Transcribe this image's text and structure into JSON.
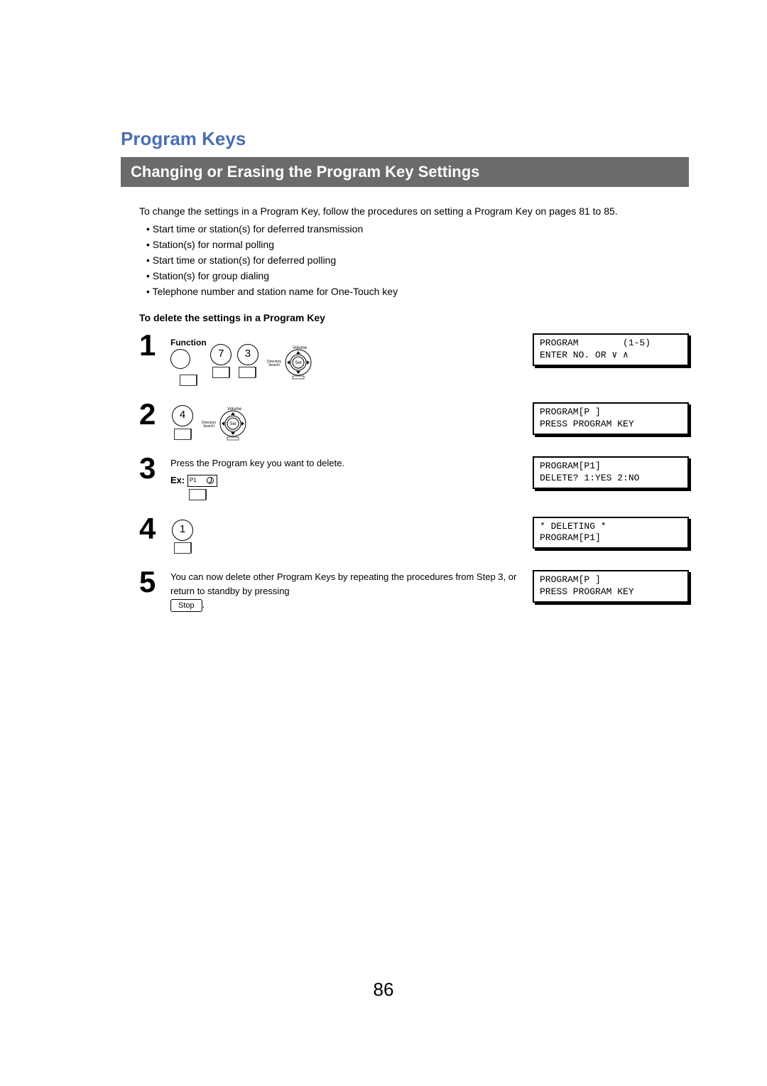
{
  "section_heading": "Program Keys",
  "title_bar": "Changing or Erasing the Program Key Settings",
  "intro_text": "To change the settings in a Program Key, follow the procedures on setting a Program Key on pages 81 to 85.",
  "bullets": [
    "Start time or station(s) for deferred transmission",
    "Station(s) for normal polling",
    "Start time or station(s) for deferred polling",
    "Station(s) for group dialing",
    "Telephone number and station name for One-Touch key"
  ],
  "subheading": "To delete the settings in a Program Key",
  "steps": [
    {
      "num": "1",
      "function_label": "Function",
      "keys": [
        "7",
        "3"
      ],
      "nav_labels": {
        "volume": "Volume",
        "dir": "Directory\nSearch",
        "set": "Set"
      },
      "lcd": "PROGRAM        (1-5)\nENTER NO. OR ∨ ∧"
    },
    {
      "num": "2",
      "keys": [
        "4"
      ],
      "nav_labels": {
        "volume": "Volume",
        "dir": "Directory\nSearch",
        "set": "Set"
      },
      "lcd": "PROGRAM[P ]\nPRESS PROGRAM KEY"
    },
    {
      "num": "3",
      "text": "Press the Program key you want to delete.",
      "ex_label": "Ex:",
      "p1_label": "P1",
      "lcd": "PROGRAM[P1]\nDELETE? 1:YES 2:NO"
    },
    {
      "num": "4",
      "keys": [
        "1"
      ],
      "lcd": "* DELETING *\nPROGRAM[P1]"
    },
    {
      "num": "5",
      "text_before": "You can now delete other Program Keys by repeating the procedures from Step 3, or return to standby by pressing ",
      "stop_label": "Stop",
      "text_after": ".",
      "lcd": "PROGRAM[P ]\nPRESS PROGRAM KEY"
    }
  ],
  "page_number": "86"
}
